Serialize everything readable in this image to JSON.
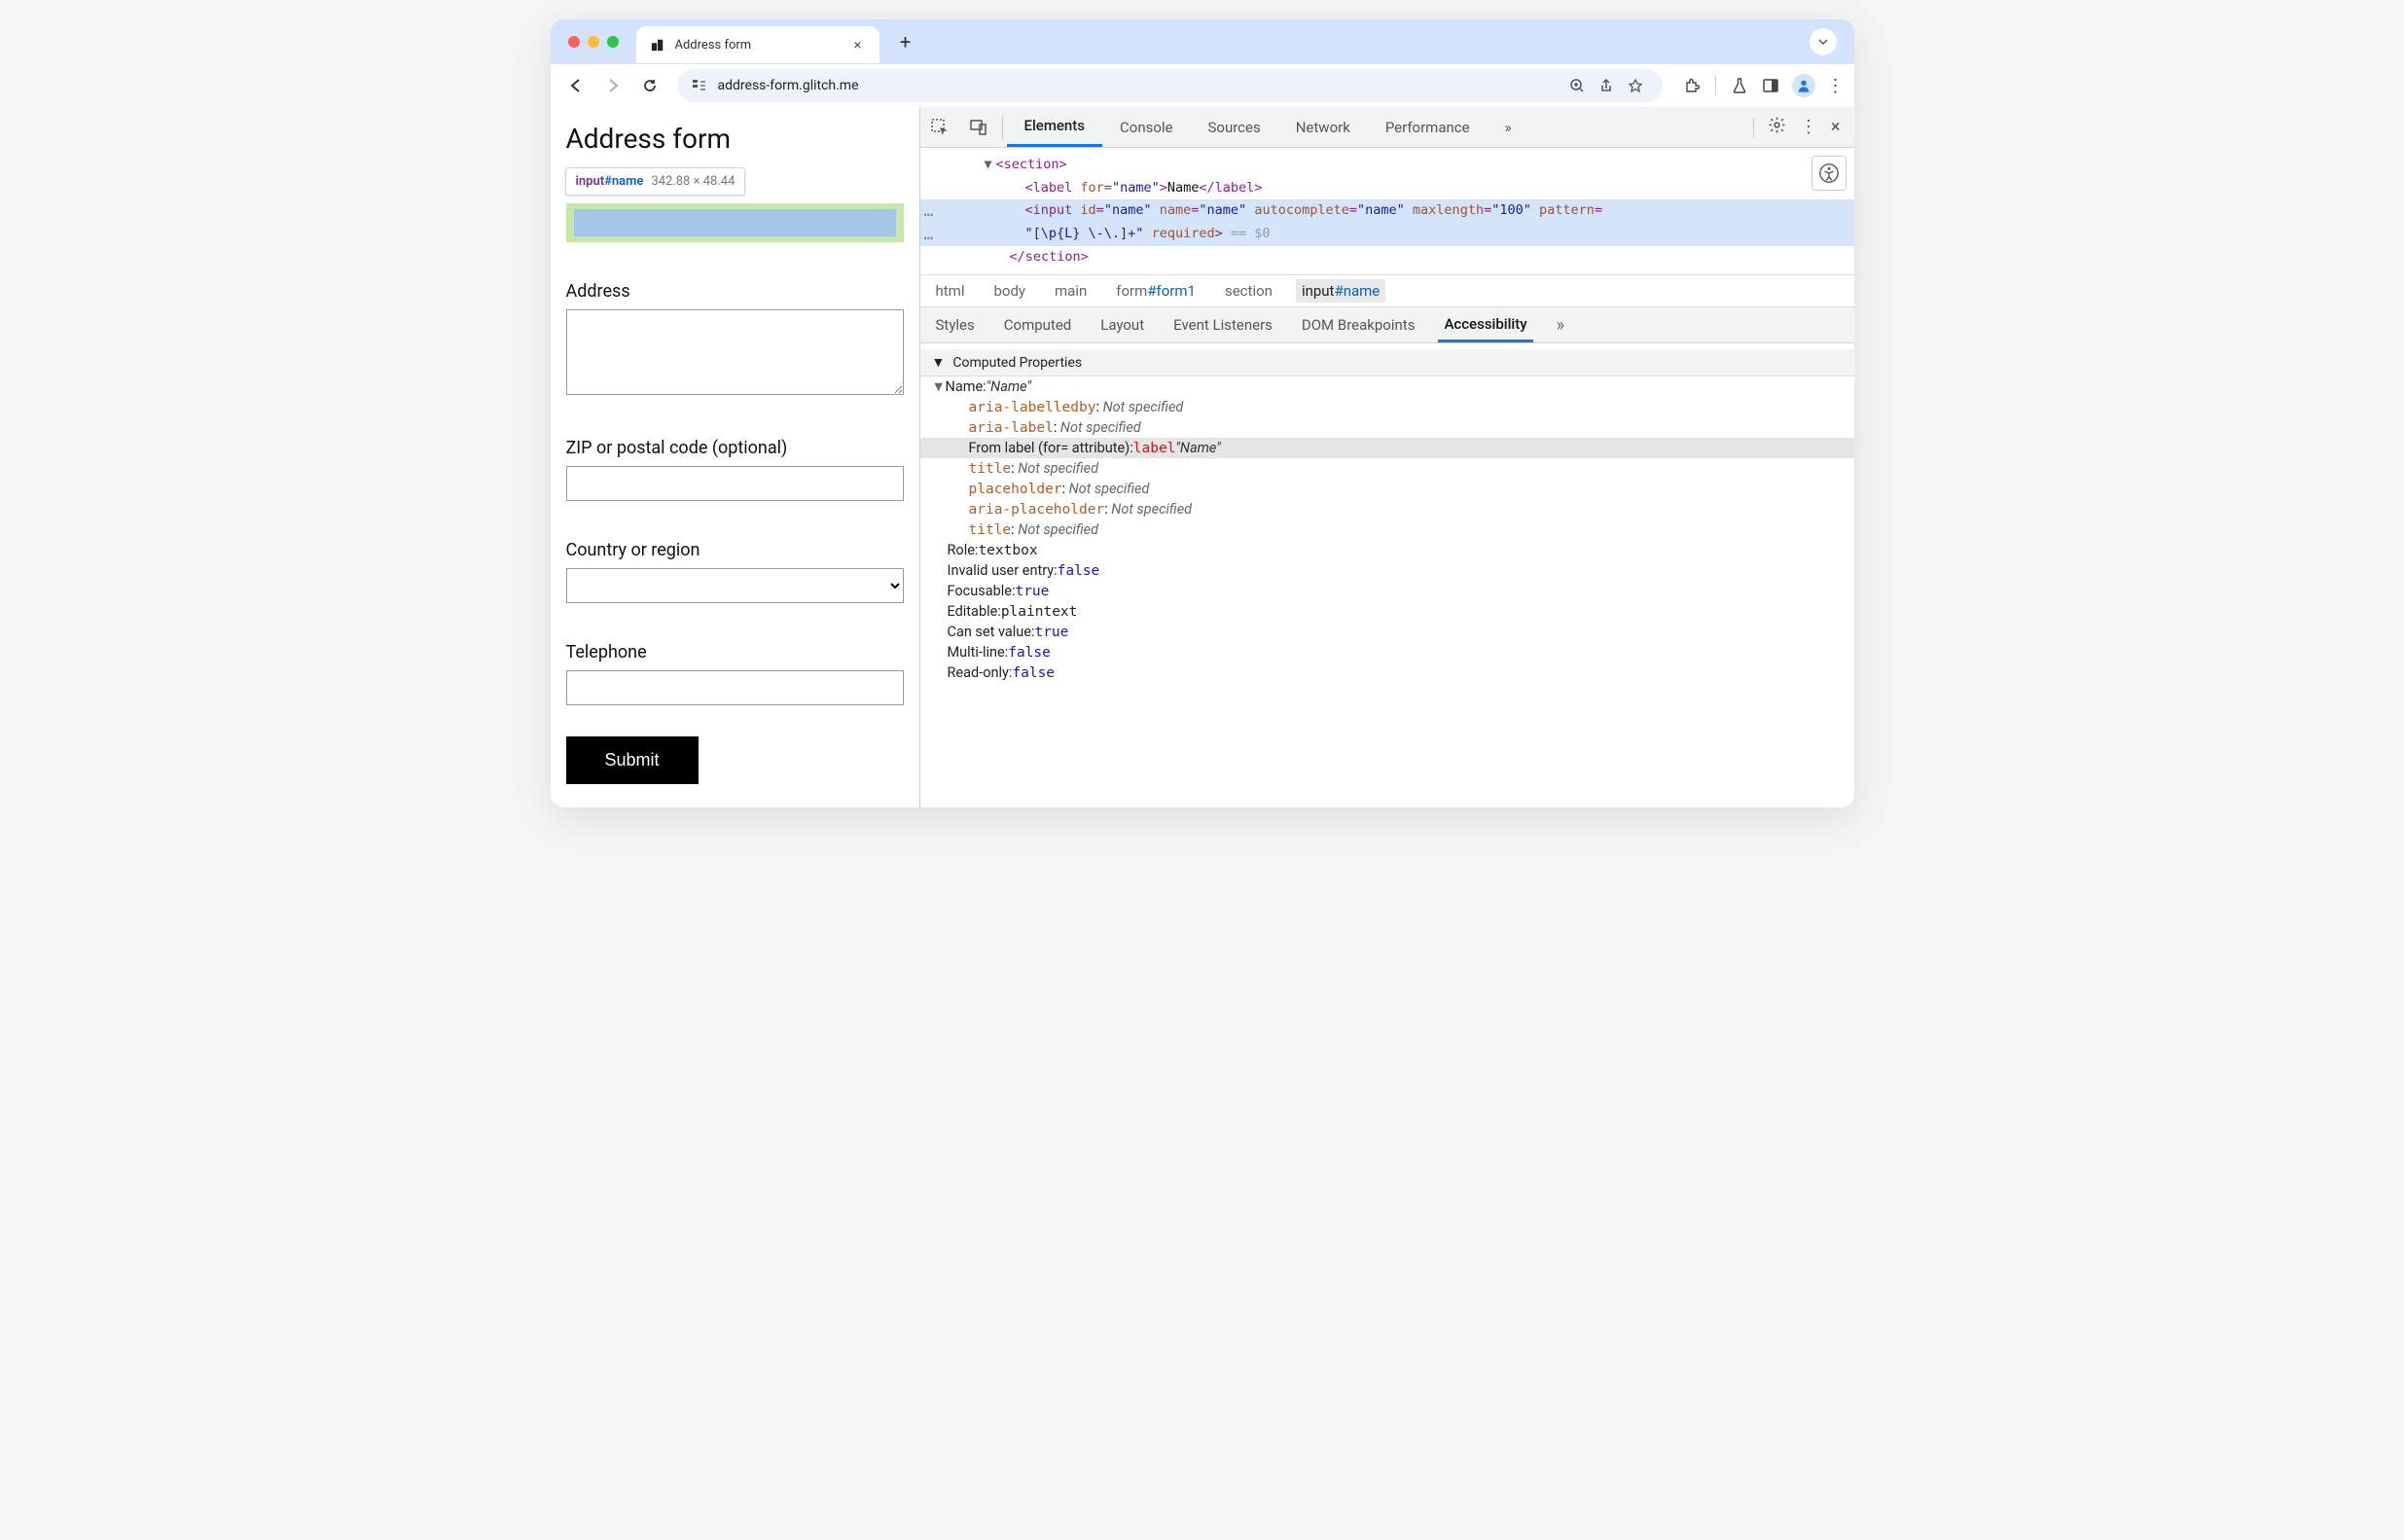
{
  "window": {
    "tab_title": "Address form",
    "url": "address-form.glitch.me"
  },
  "page": {
    "heading": "Address form",
    "tooltip_element": "input",
    "tooltip_id": "#name",
    "tooltip_dimensions": "342.88 × 48.44",
    "labels": {
      "address": "Address",
      "zip": "ZIP or postal code (optional)",
      "country": "Country or region",
      "telephone": "Telephone"
    },
    "submit": "Submit"
  },
  "devtools": {
    "tabs": [
      "Elements",
      "Console",
      "Sources",
      "Network",
      "Performance"
    ],
    "dom": {
      "section_open": "<section>",
      "label_line": {
        "open": "<label ",
        "attr": "for",
        "val": "\"name\"",
        "close": ">",
        "text": "Name",
        "end": "</label>"
      },
      "input_line": {
        "open": "<input ",
        "attrs": [
          {
            "n": "id",
            "v": "\"name\""
          },
          {
            "n": "name",
            "v": "\"name\""
          },
          {
            "n": "autocomplete",
            "v": "\"name\""
          },
          {
            "n": "maxlength",
            "v": "\"100\""
          },
          {
            "n": "pattern",
            "v": ""
          }
        ]
      },
      "input_line2_val": "\"[\\p{L} \\-\\.]+\"",
      "input_line2_req": "required",
      "eq0": " == $0",
      "section_close": "</section>"
    },
    "crumbs": [
      "html",
      "body",
      "main",
      "form#form1",
      "section",
      "input#name"
    ],
    "subtabs": [
      "Styles",
      "Computed",
      "Layout",
      "Event Listeners",
      "DOM Breakpoints",
      "Accessibility"
    ],
    "acc": {
      "section": "Computed Properties",
      "name_row": "Name: ",
      "name_val": "\"Name\"",
      "src": [
        {
          "k": "aria-labelledby",
          "v": "Not specified"
        },
        {
          "k": "aria-label",
          "v": "Not specified"
        }
      ],
      "from_label": {
        "pre": "From label (for= attribute): ",
        "kw": "label",
        "val": " \"Name\""
      },
      "src2": [
        {
          "k": "title",
          "v": "Not specified"
        },
        {
          "k": "placeholder",
          "v": "Not specified"
        },
        {
          "k": "aria-placeholder",
          "v": "Not specified"
        },
        {
          "k": "title",
          "v": "Not specified"
        }
      ],
      "props": [
        {
          "k": "Role: ",
          "v": "textbox",
          "t": "plain"
        },
        {
          "k": "Invalid user entry: ",
          "v": "false",
          "t": "bool"
        },
        {
          "k": "Focusable: ",
          "v": "true",
          "t": "bool"
        },
        {
          "k": "Editable: ",
          "v": "plaintext",
          "t": "plain"
        },
        {
          "k": "Can set value: ",
          "v": "true",
          "t": "bool"
        },
        {
          "k": "Multi-line: ",
          "v": "false",
          "t": "bool"
        },
        {
          "k": "Read-only: ",
          "v": "false",
          "t": "bool"
        }
      ]
    }
  }
}
